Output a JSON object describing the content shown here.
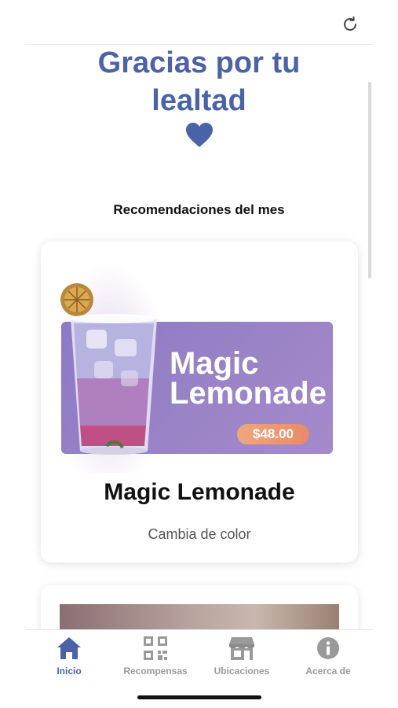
{
  "hero": {
    "title_line1": "Gracias por tu",
    "title_line2": "lealtad",
    "heart_icon": "heart-icon"
  },
  "section": {
    "title": "Recomendaciones del mes"
  },
  "recommendation": {
    "banner_title_line1": "Magic",
    "banner_title_line2": "Lemonade",
    "price": "$48.00",
    "name": "Magic Lemonade",
    "description": "Cambia de color"
  },
  "tabs": [
    {
      "label": "Inicio",
      "icon": "home-icon",
      "active": true
    },
    {
      "label": "Recompensas",
      "icon": "qr-code-icon",
      "active": false
    },
    {
      "label": "Ubicaciones",
      "icon": "store-icon",
      "active": false
    },
    {
      "label": "Acerca de",
      "icon": "info-icon",
      "active": false
    }
  ],
  "colors": {
    "accent": "#4a62a8",
    "banner": "#9a83c6",
    "price_pill": "#ec9471",
    "inactive_tab": "#9a9a9a"
  }
}
